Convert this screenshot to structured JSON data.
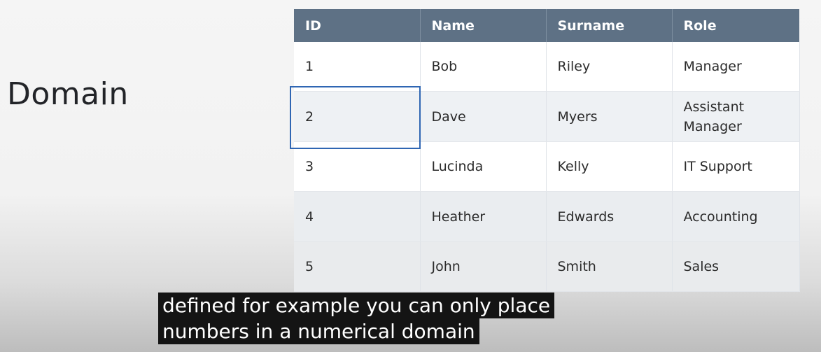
{
  "heading": "Domain",
  "table": {
    "headers": [
      "ID",
      "Name",
      "Surname",
      "Role"
    ],
    "rows": [
      [
        "1",
        "Bob",
        "Riley",
        "Manager"
      ],
      [
        "2",
        "Dave",
        "Myers",
        "Assistant Manager"
      ],
      [
        "3",
        "Lucinda",
        "Kelly",
        "IT Support"
      ],
      [
        "4",
        "Heather",
        "Edwards",
        "Accounting"
      ],
      [
        "5",
        "John",
        "Smith",
        "Sales"
      ]
    ],
    "header_color": "#5e7185",
    "highlight_color": "#2f66b3"
  },
  "caption": {
    "line1": "defined for example you can only place",
    "line2": "numbers in a numerical domain"
  }
}
